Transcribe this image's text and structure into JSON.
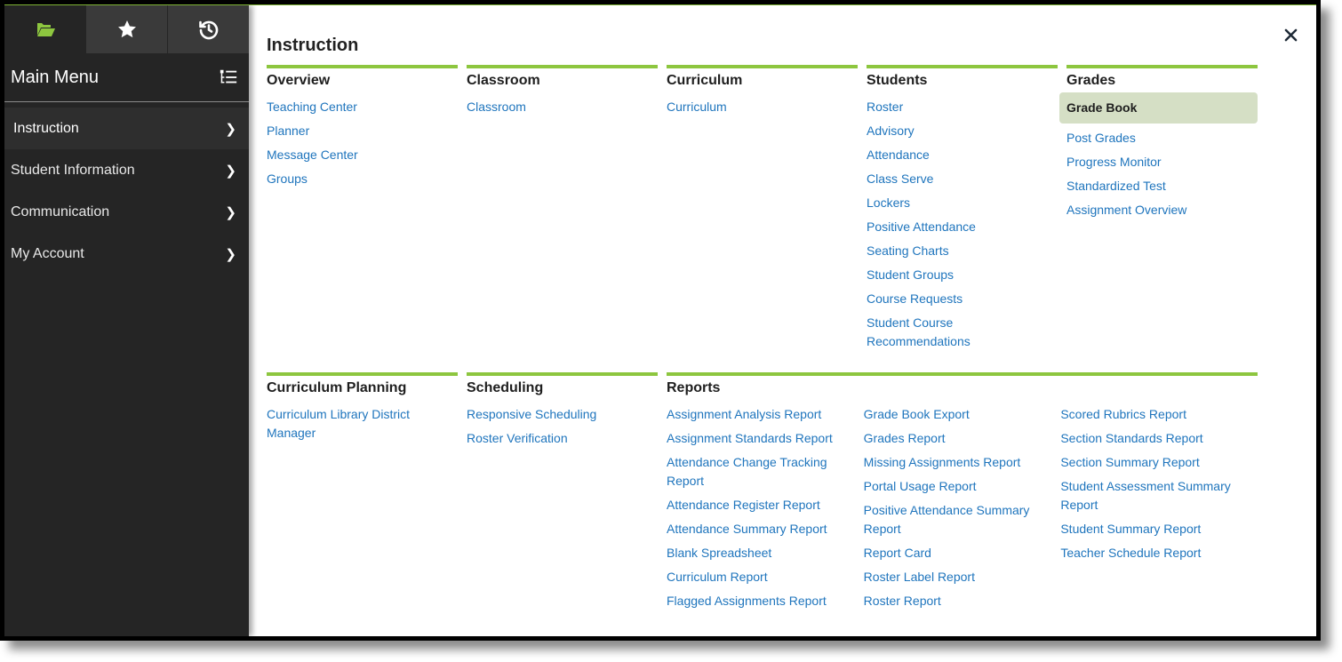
{
  "sidebar": {
    "tabs": [
      {
        "name": "folder-icon",
        "active": true
      },
      {
        "name": "star-icon",
        "active": false
      },
      {
        "name": "history-icon",
        "active": false
      }
    ],
    "title": "Main Menu",
    "items": [
      {
        "label": "Instruction",
        "active": true
      },
      {
        "label": "Student Information",
        "active": false
      },
      {
        "label": "Communication",
        "active": false
      },
      {
        "label": "My Account",
        "active": false
      }
    ]
  },
  "main": {
    "title": "Instruction",
    "close_label": "Close",
    "sections": {
      "overview": {
        "title": "Overview",
        "links": [
          "Teaching Center",
          "Planner",
          "Message Center",
          "Groups"
        ]
      },
      "classroom": {
        "title": "Classroom",
        "links": [
          "Classroom"
        ]
      },
      "curriculum": {
        "title": "Curriculum",
        "links": [
          "Curriculum"
        ]
      },
      "students": {
        "title": "Students",
        "links": [
          "Roster",
          "Advisory",
          "Attendance",
          "Class Serve",
          "Lockers",
          "Positive Attendance",
          "Seating Charts",
          "Student Groups",
          "Course Requests",
          "Student Course Recommendations"
        ]
      },
      "grades": {
        "title": "Grades",
        "selected": "Grade Book",
        "links": [
          "Grade Book",
          "Post Grades",
          "Progress Monitor",
          "Standardized Test",
          "Assignment Overview"
        ]
      },
      "curriculum_planning": {
        "title": "Curriculum Planning",
        "links": [
          "Curriculum Library District Manager"
        ]
      },
      "scheduling": {
        "title": "Scheduling",
        "links": [
          "Responsive Scheduling",
          "Roster Verification"
        ]
      },
      "reports": {
        "title": "Reports",
        "columns": [
          [
            "Assignment Analysis Report",
            "Assignment Standards Report",
            "Attendance Change Tracking Report",
            "Attendance Register Report",
            "Attendance Summary Report",
            "Blank Spreadsheet",
            "Curriculum Report",
            "Flagged Assignments Report"
          ],
          [
            "Grade Book Export",
            "Grades Report",
            "Missing Assignments Report",
            "Portal Usage Report",
            "Positive Attendance Summary Report",
            "Report Card",
            "Roster Label Report",
            "Roster Report"
          ],
          [
            "Scored Rubrics Report",
            "Section Standards Report",
            "Section Summary Report",
            "Student Assessment Summary Report",
            "Student Summary Report",
            "Teacher Schedule Report"
          ]
        ]
      }
    }
  },
  "colors": {
    "accent": "#8dc63f",
    "link": "#1f75bd",
    "sidebar_bg": "#252525",
    "selected_bg": "#d5dfc5"
  }
}
